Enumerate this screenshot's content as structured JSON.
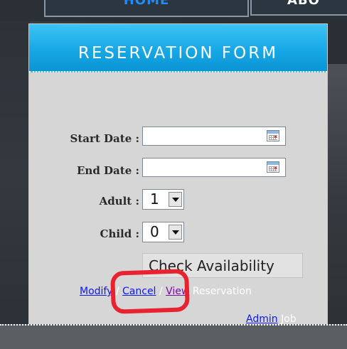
{
  "nav": {
    "home_label": "HOME",
    "about_label": "ABO"
  },
  "form": {
    "title": "RESERVATION FORM",
    "start_date_label": "Start Date :",
    "start_date_value": "",
    "end_date_label": "End Date :",
    "end_date_value": "",
    "adult_label": "Adult :",
    "adult_value": "1",
    "child_label": "Child :",
    "child_value": "0",
    "check_button_label": "Check Availability"
  },
  "links": {
    "modify": "Modify",
    "sep1": " / ",
    "cancel": "Cancel",
    "sep2": " / ",
    "view": "View",
    "reservation_suffix": " Reservation",
    "admin": "Admin",
    "job_suffix": " Job"
  },
  "colors": {
    "header_accent": "#17a8e6",
    "link": "#0b16ff",
    "visited_link": "#7a0aa6",
    "highlight": "#e8222e"
  },
  "icons": {
    "calendar": "calendar-icon",
    "dropdown_arrow": "chevron-down-icon"
  }
}
